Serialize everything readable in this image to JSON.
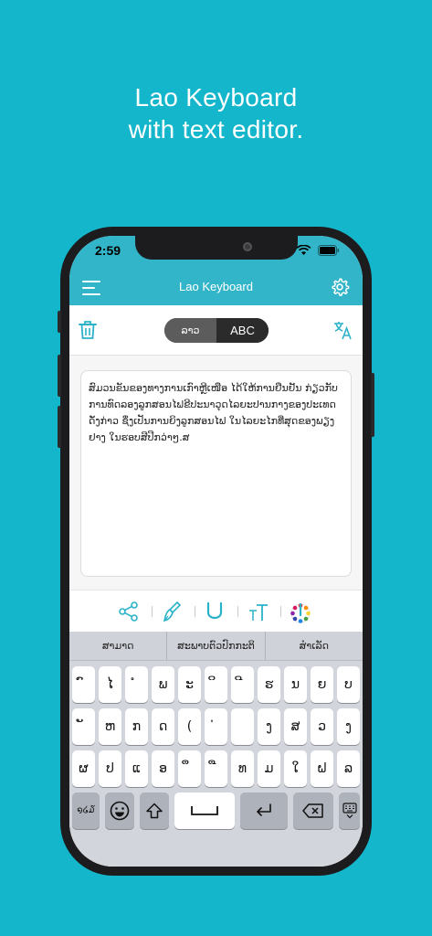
{
  "headline": {
    "line1": "Lao Keyboard",
    "line2": "with text editor."
  },
  "status": {
    "time": "2:59"
  },
  "navbar": {
    "title": "Lao Keyboard"
  },
  "toggle": {
    "lao": "ລາວ",
    "abc": "ABC"
  },
  "editor": {
    "text": "ສົມວນຂັນຂອງທາງການເກົາຫຼີເໜືອ ໄດ້ໃຫ້ການຢືນຢັນ ກ່ຽວກັບການທົດລອງລູກສອນໄຟຂີປະນາວຸດໄລຍະປານກາງຂອງປະເທດດັ່ງກ່າວ ຊຶ່ງເປັນການຍິງລູກສອນໄຟ ໃນໄລຍະໄກທີ່ສຸດຂອງພຽງຢາງ ໃນຮອບສີປີກວ່າໆ.ສ"
  },
  "suggestions": [
    "ສາມາດ",
    "ສະພາບຕົວປົກກະຕິ",
    "ສຳເລັດ"
  ],
  "keyboard": {
    "row1": [
      "ົ",
      "ໄ",
      "ໍ",
      "ພ",
      "ະ",
      "ິ",
      "ີ",
      "ຮ",
      "ນ",
      "ຍ",
      "ບ"
    ],
    "row2": [
      "ັ",
      "ຫ",
      "ກ",
      "ດ",
      "(",
      "່",
      "",
      "ງ",
      "ສ",
      "ວ",
      "ງ"
    ],
    "row3": [
      "ຜ",
      "ປ",
      "ແ",
      "ອ",
      "ຶ",
      "ື",
      "ທ",
      "ມ",
      "ໃ",
      "ຝ",
      "ລ"
    ],
    "numbers_key": "໑໒໓"
  },
  "colors": {
    "background": "#14b6cb",
    "navbar": "#33b5c9",
    "accent": "#2bb2c9"
  },
  "icons": [
    "menu-icon",
    "gear-icon",
    "trash-icon",
    "translate-icon",
    "share-icon",
    "brush-icon",
    "underline-icon",
    "text-size-icon",
    "color-palette-icon",
    "emoji-icon",
    "shift-icon",
    "space-icon",
    "return-icon",
    "backspace-icon",
    "keyboard-hide-icon"
  ]
}
